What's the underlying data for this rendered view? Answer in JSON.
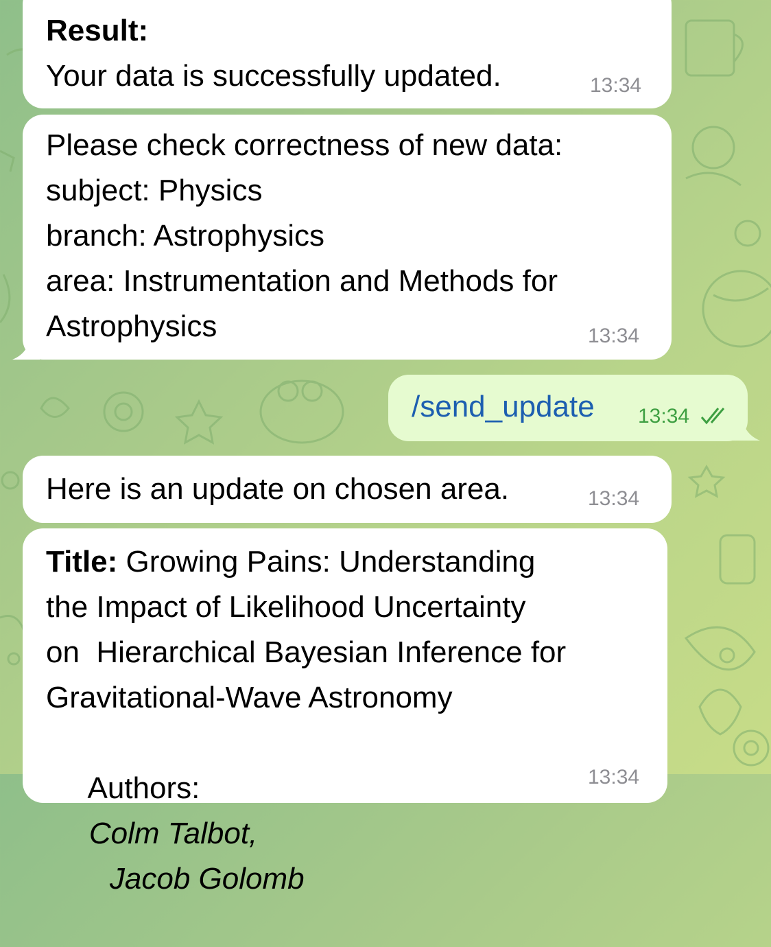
{
  "messages": {
    "result": {
      "heading": "Result:",
      "text": "Your data is successfully updated.",
      "time": "13:34"
    },
    "check": {
      "line1": "Please check correctness of new data:",
      "line2": "subject: Physics",
      "line3": "branch: Astrophysics",
      "line4": "area: Instrumentation and Methods for",
      "line5": "Astrophysics",
      "time": "13:34"
    },
    "command": {
      "text": "/send_update",
      "time": "13:34",
      "status_icon": "double-check-icon"
    },
    "update_intro": {
      "text": "Here is an update on chosen area.",
      "time": "13:34"
    },
    "paper": {
      "title_label": "Title:",
      "title_line1": "Growing Pains: Understanding",
      "title_line2": "the Impact of Likelihood Uncertainty",
      "title_line3": "on  Hierarchical Bayesian Inference for",
      "title_line4": "Gravitational-Wave Astronomy",
      "authors_label": "Authors:",
      "author1": "Colm Talbot,",
      "author2": "Jacob Golomb",
      "time": "13:34"
    }
  },
  "colors": {
    "incoming_bubble": "#ffffff",
    "outgoing_bubble": "#e6fbd0",
    "command_link": "#1d5fb0",
    "outgoing_time": "#3e9f42",
    "incoming_time": "#8e8e93"
  }
}
